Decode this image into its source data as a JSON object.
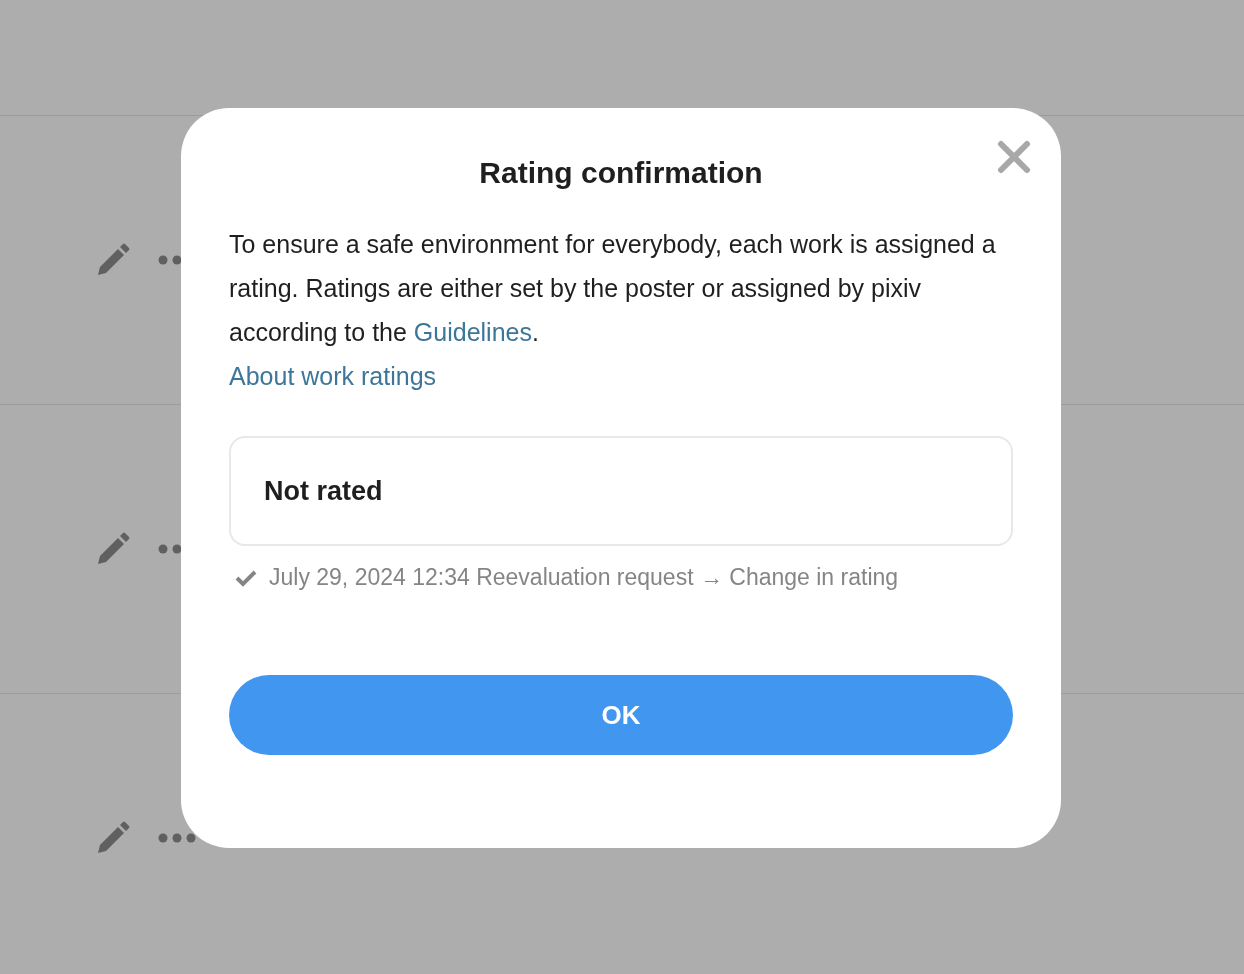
{
  "background_rows": [
    {
      "kind": "work"
    },
    {
      "kind": "work"
    },
    {
      "kind": "work"
    }
  ],
  "dialog": {
    "title": "Rating confirmation",
    "body": {
      "text_before": "To ensure a safe environment for everybody, each work is assigned a rating. Ratings are either set by the poster or assigned by pixiv according to the ",
      "link": "Guidelines",
      "text_after": "."
    },
    "about_link": "About work ratings",
    "rating": "Not rated",
    "history": [
      {
        "text": "July 29, 2024 12:34 Reevaluation request → Change in rating",
        "done": true
      }
    ],
    "button": "OK"
  }
}
